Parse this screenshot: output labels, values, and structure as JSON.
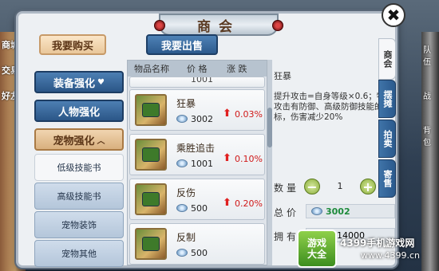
{
  "window": {
    "title": "商会"
  },
  "top_tabs": {
    "buy": "我要购买",
    "sell": "我要出售"
  },
  "categories": [
    {
      "label": "装备强化",
      "chevron": "♥"
    },
    {
      "label": "人物强化"
    },
    {
      "label": "宠物强化",
      "chevron": "︿"
    }
  ],
  "subcategories": [
    "低级技能书",
    "高级技能书",
    "宠物装饰",
    "宠物其他"
  ],
  "list": {
    "headers": {
      "name": "物品名称",
      "price": "价 格",
      "change": "涨 跌"
    },
    "partial_row_price": "1001",
    "items": [
      {
        "name": "狂暴",
        "price": "3002",
        "change": "0.03%",
        "trend": "up"
      },
      {
        "name": "乘胜追击",
        "price": "1001",
        "change": "0.10%",
        "trend": "up"
      },
      {
        "name": "反伤",
        "price": "500",
        "change": "0.20%",
        "trend": "up"
      },
      {
        "name": "反制",
        "price": "500",
        "change": ""
      }
    ]
  },
  "detail": {
    "title": "狂暴",
    "description": "提升攻击=自身等级×0.6；物理攻击有防御、高级防御技能的目标，伤害减少20%",
    "qty_label": "数量",
    "qty_value": "1",
    "total_label": "总价",
    "total_value": "3002",
    "own_label": "拥有",
    "own_value": "1214000"
  },
  "side_tabs": [
    "商会",
    "摆摊",
    "拍卖",
    "寄售"
  ],
  "background": {
    "left_labels": [
      "商城",
      "交易",
      "好友"
    ],
    "right_labels": [
      "队伍",
      "战",
      "背包"
    ]
  },
  "watermark": {
    "logo_top": "游戏",
    "logo_bottom": "大全",
    "text": "4399手机游戏网",
    "url": "www.4399.cn"
  },
  "colors": {
    "up": "#e02020",
    "accent_blue": "#2b5a8d",
    "currency_green": "#1c8a3a"
  }
}
